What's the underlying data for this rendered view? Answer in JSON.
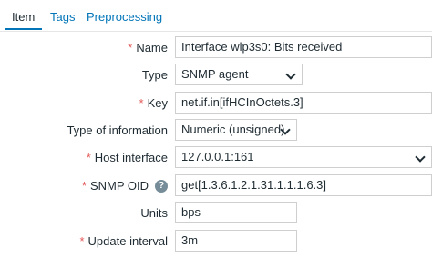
{
  "tabs": [
    {
      "label": "Item"
    },
    {
      "label": "Tags"
    },
    {
      "label": "Preprocessing"
    }
  ],
  "required_marker": "*",
  "help_icon_glyph": "?",
  "form": {
    "name": {
      "label": "Name",
      "value": "Interface wlp3s0: Bits received"
    },
    "type": {
      "label": "Type",
      "value": "SNMP agent"
    },
    "key": {
      "label": "Key",
      "value": "net.if.in[ifHCInOctets.3]"
    },
    "type_of_information": {
      "label": "Type of information",
      "value": "Numeric (unsigned)"
    },
    "host_interface": {
      "label": "Host interface",
      "value": "127.0.0.1:161"
    },
    "snmp_oid": {
      "label": "SNMP OID",
      "value": "get[1.3.6.1.2.1.31.1.1.1.6.3]"
    },
    "units": {
      "label": "Units",
      "value": "bps"
    },
    "update_interval": {
      "label": "Update interval",
      "value": "3m"
    }
  },
  "colors": {
    "link": "#0275b8",
    "required": "#e45959",
    "text": "#1f2c33",
    "help_icon_bg": "#768d99",
    "field_border": "#cfcfcf"
  }
}
